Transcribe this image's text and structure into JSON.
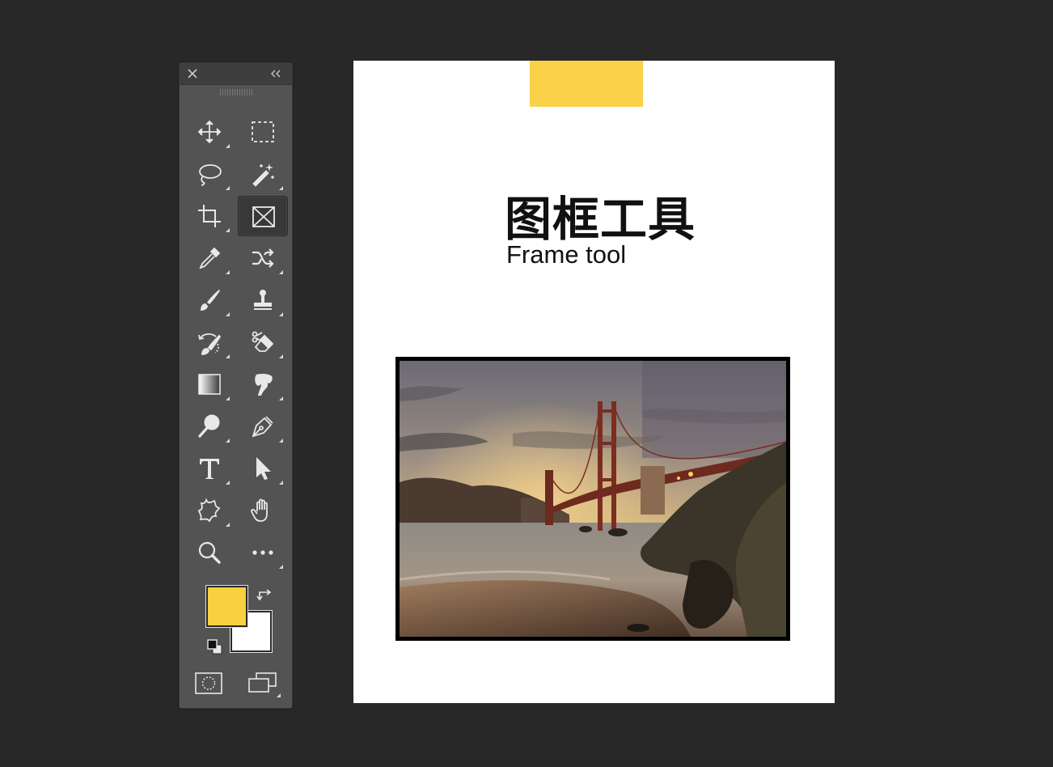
{
  "app": {
    "canvas_background": "#282828",
    "accent_color": "#F9D24A"
  },
  "toolbar": {
    "close_icon": "close-icon",
    "collapse_icon": "double-chevron-left-icon",
    "tools": [
      {
        "name": "move-tool",
        "icon": "move-icon"
      },
      {
        "name": "rectangular-marquee-tool",
        "icon": "marquee-icon"
      },
      {
        "name": "lasso-tool",
        "icon": "lasso-icon"
      },
      {
        "name": "magic-wand-tool",
        "icon": "magic-wand-icon"
      },
      {
        "name": "crop-tool",
        "icon": "crop-icon"
      },
      {
        "name": "frame-tool",
        "icon": "frame-icon",
        "active": true
      },
      {
        "name": "eyedropper-tool",
        "icon": "eyedropper-icon"
      },
      {
        "name": "content-aware-move-tool",
        "icon": "shuffle-icon"
      },
      {
        "name": "brush-tool",
        "icon": "brush-icon"
      },
      {
        "name": "clone-stamp-tool",
        "icon": "stamp-icon"
      },
      {
        "name": "history-brush-tool",
        "icon": "history-brush-icon"
      },
      {
        "name": "eraser-tool",
        "icon": "eraser-icon"
      },
      {
        "name": "gradient-tool",
        "icon": "gradient-icon"
      },
      {
        "name": "smudge-tool",
        "icon": "smudge-icon"
      },
      {
        "name": "dodge-tool",
        "icon": "dodge-icon"
      },
      {
        "name": "pen-tool",
        "icon": "pen-icon"
      },
      {
        "name": "type-tool",
        "icon": "type-icon"
      },
      {
        "name": "path-selection-tool",
        "icon": "arrow-icon"
      },
      {
        "name": "custom-shape-tool",
        "icon": "shape-icon"
      },
      {
        "name": "hand-tool",
        "icon": "hand-icon"
      },
      {
        "name": "zoom-tool",
        "icon": "zoom-icon"
      },
      {
        "name": "edit-toolbar",
        "icon": "more-icon"
      }
    ],
    "foreground_color": "#F9D03F",
    "background_color": "#FFFFFF"
  },
  "document": {
    "title_cn": "图框工具",
    "title_en": "Frame tool",
    "accent_block_color": "#F9D24A",
    "frame_image": "golden-gate-bridge-photo"
  }
}
